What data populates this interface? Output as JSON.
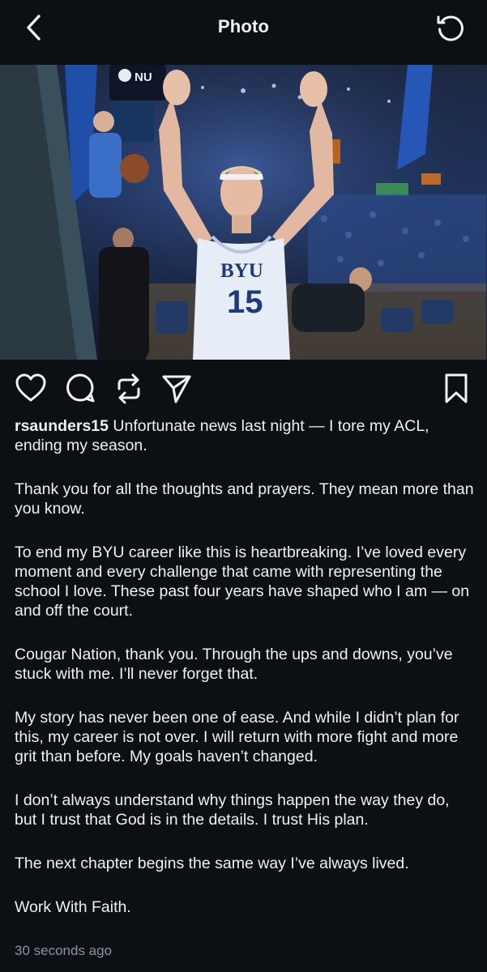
{
  "header": {
    "title": "Photo",
    "back_icon": "chevron-left-icon",
    "refresh_icon": "refresh-icon"
  },
  "photo": {
    "jersey_text": "BYU",
    "jersey_number": "15",
    "scoreboard_text": "NU"
  },
  "actions": {
    "icons": [
      "heart-icon",
      "comment-icon",
      "repost-icon",
      "share-icon",
      "bookmark-icon"
    ]
  },
  "post": {
    "username": "rsaunders15",
    "paragraphs": [
      "Unfortunate news last night — I tore my ACL, ending my season.",
      "Thank you for all the thoughts and prayers. They mean more than you know.",
      "To end my BYU career like this is heartbreaking. I’ve loved every moment and every challenge that came with representing the school I love. These past four years have shaped who I am — on and off the court.",
      "Cougar Nation, thank you. Through the ups and downs, you’ve stuck with me. I’ll never forget that.",
      "My story has never been one of ease. And while I didn’t plan for this, my career is not over. I will return with more fight and more grit than before. My goals haven’t changed.",
      "I don’t always understand why things happen the way they do, but I trust that God is in the details. I trust His plan.",
      "The next chapter begins the same way I’ve always lived.",
      "Work With Faith."
    ],
    "timestamp": "30 seconds ago"
  },
  "colors": {
    "background": "#0c0f14",
    "text": "#f2f3f5",
    "muted": "#8e9299",
    "jersey": "#e6edf6",
    "jersey_text": "#1e3a7a"
  }
}
